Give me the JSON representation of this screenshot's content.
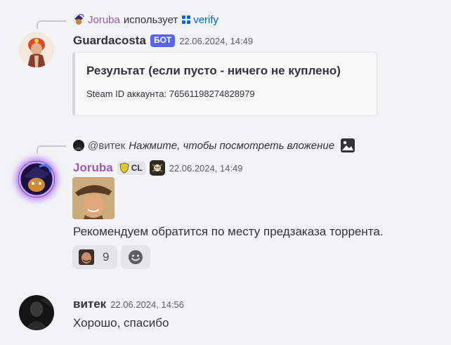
{
  "colors": {
    "background": "#f2f3f5",
    "bot_badge": "#5865f2",
    "joruba_name": "#9b59b6",
    "link": "#0068e0",
    "text": "#313338",
    "muted": "#5c5e66"
  },
  "messages": [
    {
      "reply": {
        "username": "Joruba",
        "action": "использует",
        "command": "verify",
        "command_icon": "apps-icon"
      },
      "author": "Guardacosta",
      "badge": "БОТ",
      "timestamp": "22.06.2024, 14:49",
      "embed": {
        "title": "Результат (если пусто - ничего не куплено)",
        "field": "Steam ID аккаунта: 76561198274828979"
      }
    },
    {
      "reply": {
        "username": "@витек",
        "text": "Нажмите, чтобы посмотреть вложение",
        "attachment_icon": "image-icon"
      },
      "author": "Joruba",
      "role_tag": "CL",
      "role_icon": "shield-icon",
      "server_icon": "skull-pirate-icon",
      "timestamp": "22.06.2024, 14:49",
      "content": "Рекомендуем обратится по месту предзаказа торрента.",
      "reactions": [
        {
          "emoji": "custom-face-emoji",
          "count": "9"
        }
      ],
      "add_reaction_icon": "smile-icon"
    },
    {
      "author": "витек",
      "timestamp": "22.06.2024, 14:56",
      "content": "Хорошо, спасибо"
    }
  ]
}
